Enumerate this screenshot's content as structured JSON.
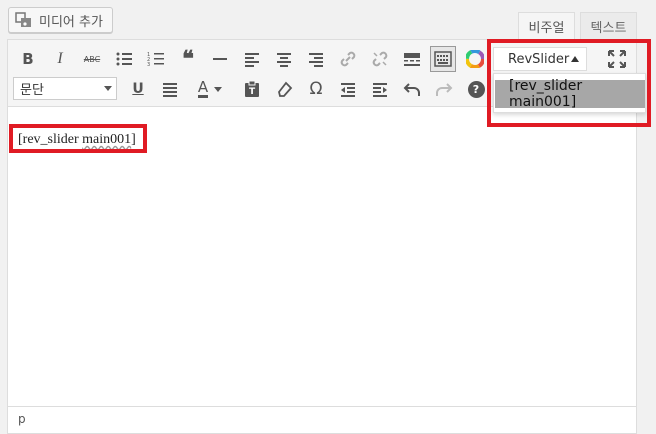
{
  "media": {
    "label": "미디어 추가"
  },
  "tabs": {
    "visual": "비주얼",
    "text": "텍스트"
  },
  "toolbar": {
    "row1": [
      "bold-icon",
      "italic-icon",
      "strikethrough-icon",
      "bullet-list-icon",
      "numbered-list-icon",
      "blockquote-icon",
      "horizontal-line-icon",
      "align-left-icon",
      "align-center-icon",
      "align-right-icon",
      "link-icon",
      "unlink-icon",
      "read-more-icon",
      "toolbar-toggle-icon",
      "color-wheel-icon"
    ],
    "row2": [
      "underline-icon",
      "justify-icon",
      "text-color-icon",
      "paste-as-text-icon",
      "clear-formatting-icon",
      "special-character-icon",
      "outdent-icon",
      "indent-icon",
      "undo-icon",
      "redo-icon",
      "help-icon"
    ],
    "format_select": "문단",
    "bold": "B",
    "italic": "I",
    "strike": "ABC",
    "underline": "U",
    "textcolor": "A",
    "omega": "Ω",
    "help": "?",
    "quote": "❝"
  },
  "revslider": {
    "label": "RevSlider",
    "dropdown_items": [
      "[rev_slider main001]"
    ]
  },
  "content": {
    "shortcode_prefix": "[rev_slider ",
    "shortcode_name": "main001",
    "shortcode_suffix": "]"
  },
  "status": {
    "path": "p"
  },
  "colors": {
    "highlight": "#e01b24",
    "dropdown_item_bg": "#a7a7a7",
    "toolbar_bg": "#f5f5f5"
  }
}
